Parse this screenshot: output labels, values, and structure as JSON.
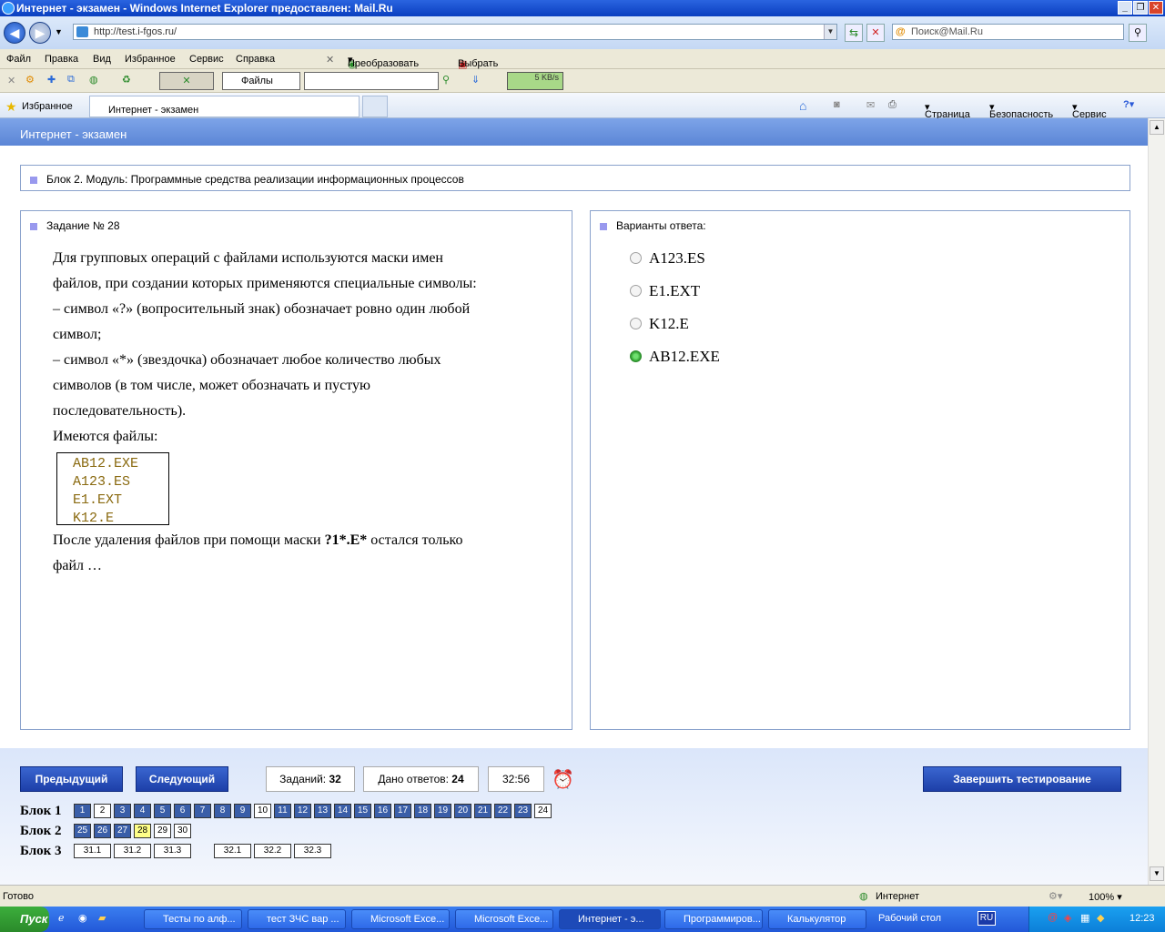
{
  "window": {
    "title": "Интернет - экзамен - Windows Internet Explorer предоставлен: Mail.Ru"
  },
  "browser": {
    "url": "http://test.i-fgos.ru/",
    "search_placeholder": "Поиск@Mail.Ru",
    "menu": [
      "Файл",
      "Правка",
      "Вид",
      "Избранное",
      "Сервис",
      "Справка"
    ],
    "convert": "Преобразовать",
    "select": "Выбрать",
    "files_combo": "Файлы",
    "speed": "5 KB/s",
    "favorites": "Избранное",
    "tab": "Интернет - экзамен",
    "cmd": [
      "Страница",
      "Безопасность",
      "Сервис"
    ]
  },
  "app": {
    "header": "Интернет - экзамен",
    "block_title": "Блок 2. Модуль: Программные средства реализации информационных процессов",
    "task_title": "Задание № 28",
    "question_lines": [
      "Для групповых операций с файлами используются маски имен",
      "файлов, при создании которых применяются специальные символы:",
      "– символ «?» (вопросительный знак) обозначает ровно один любой",
      "символ;",
      "– символ «*» (звездочка) обозначает любое количество любых",
      "символов (в том числе, может обозначать и пустую",
      "последовательность).",
      "Имеются файлы:"
    ],
    "files": [
      "AB12.EXE",
      "A123.ES",
      "E1.EXT",
      "K12.E"
    ],
    "after_text_a": "После удаления файлов при помощи маски ",
    "mask": "?1*.E*",
    "after_text_b": "  остался только",
    "after_text_c": "файл …",
    "answers_title": "Варианты ответа:",
    "answers": [
      {
        "text": "A123.ES",
        "selected": false
      },
      {
        "text": "E1.EXT",
        "selected": false
      },
      {
        "text": "K12.E",
        "selected": false
      },
      {
        "text": "AB12.EXE",
        "selected": true
      }
    ],
    "prev": "Предыдущий",
    "next": "Следующий",
    "tasks_label": "Заданий:",
    "tasks_count": "32",
    "answered_label": "Дано ответов:",
    "answered_count": "24",
    "timer": "32:56",
    "finish": "Завершить тестирование",
    "blocks": [
      {
        "label": "Блок 1",
        "items": [
          "1",
          "2",
          "3",
          "4",
          "5",
          "6",
          "7",
          "8",
          "9",
          "10",
          "11",
          "12",
          "13",
          "14",
          "15",
          "16",
          "17",
          "18",
          "19",
          "20",
          "21",
          "22",
          "23",
          "24"
        ],
        "white": [
          "2",
          "10",
          "24"
        ]
      },
      {
        "label": "Блок 2",
        "items": [
          "25",
          "26",
          "27",
          "28",
          "29",
          "30"
        ],
        "white": [
          "29",
          "30"
        ],
        "current": "28"
      },
      {
        "label": "Блок 3",
        "items": [
          "31.1",
          "31.2",
          "31.3",
          "32.1",
          "32.2",
          "32.3"
        ],
        "white": [
          "31.1",
          "31.2",
          "31.3",
          "32.1",
          "32.2",
          "32.3"
        ]
      }
    ]
  },
  "status": {
    "text": "Готово",
    "zone": "Интернет",
    "zoom": "100%"
  },
  "taskbar": {
    "start": "Пуск",
    "tasks": [
      "Тесты по алф...",
      "тест ЗЧС вар ...",
      "Microsoft Exce...",
      "Microsoft Exce...",
      "Интернет - э...",
      "Программиров...",
      "Калькулятор"
    ],
    "desktop": "Рабочий стол",
    "lang": "RU",
    "clock": "12:23"
  }
}
